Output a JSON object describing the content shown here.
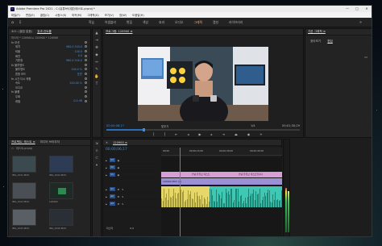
{
  "window": {
    "title": "Adobe Premiere Pro 2021 - C:\\유튜브\\대본\\테스트.prproj *",
    "controls": [
      "—",
      "□",
      "✕"
    ]
  },
  "menu": [
    "파일(F)",
    "편집(E)",
    "클립(C)",
    "시퀀스(S)",
    "마커(M)",
    "그래픽(G)",
    "보기(V)",
    "창(W)",
    "도움말(H)"
  ],
  "workspaces": {
    "items": [
      "학습",
      "어셈블리",
      "편집",
      "색상",
      "효과",
      "오디오",
      "그래픽",
      "캡션",
      "라이브러리"
    ],
    "active": "그래픽"
  },
  "effect_controls": {
    "tabs": [
      "소스: (클립 없음)",
      "효과 컨트롤",
      "오디오 트랙 믹서"
    ],
    "active_tab": "효과 컨트롤",
    "header": "마스터 * 120900 ▸ 120900 * 120900",
    "rows": [
      {
        "label": "fx 모션",
        "value": ""
      },
      {
        "label": "위치",
        "value": "960.0  540.0"
      },
      {
        "label": "비율",
        "value": "100.0"
      },
      {
        "label": "회전",
        "value": "0.0"
      },
      {
        "label": "기준점",
        "value": "960.0  540.0"
      },
      {
        "label": "fx 불투명도",
        "value": ""
      },
      {
        "label": "불투명도",
        "value": "100.0 %"
      },
      {
        "label": "혼합 모드",
        "value": "표준"
      },
      {
        "label": "fx 시간 다시 매핑",
        "value": ""
      },
      {
        "label": "속도",
        "value": "100.00 %"
      },
      {
        "label": "오디오",
        "value": ""
      },
      {
        "label": "fx 볼륨",
        "value": ""
      },
      {
        "label": "우회",
        "value": ""
      },
      {
        "label": "레벨",
        "value": "0.0 dB"
      }
    ]
  },
  "program": {
    "title": "프로그램: 120900 ≡",
    "timecode_left": "00;00;06;17",
    "fit": "맞추기",
    "quality": "1/4",
    "timecode_right": "00;01;30;29"
  },
  "essential_graphics": {
    "title": "기본 그래픽 ≡",
    "tabs": [
      "찾아보기",
      "편집"
    ],
    "active_tab": "편집"
  },
  "project": {
    "title": "프로젝트: 테스트 ≡",
    "tabs": [
      "미디어 브라우저",
      "라이브러리"
    ],
    "bin": "테스트.prproj",
    "items": [
      {
        "name": "IMG_2011.MOV",
        "duration": "1:22"
      },
      {
        "name": "IMG_2012.MOV",
        "duration": "0:25"
      },
      {
        "name": "IMG_2013.MOV",
        "duration": "0:41"
      },
      {
        "name": "120900",
        "duration": "1:30:29"
      },
      {
        "name": "IMG_2015.MOV",
        "duration": "0:12"
      },
      {
        "name": "IMG_2016.MOV",
        "duration": "0:33"
      }
    ]
  },
  "timeline": {
    "title": "120900 ≡",
    "timecode": "00;00;06;17",
    "ruler": [
      "00;00",
      "00;00;15;00",
      "00;00;30;00",
      "00;00;45;00"
    ],
    "tracks": [
      "V3",
      "V2",
      "V1",
      "A1",
      "A2",
      "A3"
    ],
    "text_clip_label": "안녕 유튜브 테스트",
    "text_clip_label2": "안녕 유튜브 테스트입니다",
    "video_clip_label": "120900.MOV [V]",
    "master_label": "마스터",
    "master_value": "0.0"
  },
  "colors": {
    "accent_orange": "#e8b48a",
    "timecode_blue": "#3b8de0",
    "video_clip": "#9b8fd6",
    "text_clip": "#d79fd6",
    "audio_a1": "#e5d869",
    "audio_a2": "#3fc8b4"
  }
}
